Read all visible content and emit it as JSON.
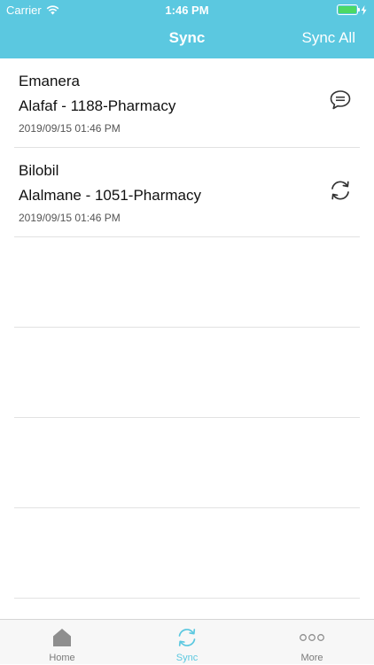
{
  "status": {
    "carrier": "Carrier",
    "time": "1:46 PM"
  },
  "header": {
    "title": "Sync",
    "action": "Sync All"
  },
  "items": [
    {
      "name": "Emanera",
      "place": "Alafaf - 1188-Pharmacy",
      "timestamp": "2019/09/15 01:46 PM",
      "icon": "chat-bubble-icon"
    },
    {
      "name": "Bilobil",
      "place": "Alalmane - 1051-Pharmacy",
      "timestamp": "2019/09/15 01:46 PM",
      "icon": "sync-icon"
    }
  ],
  "tabs": [
    {
      "label": "Home",
      "icon": "home-icon"
    },
    {
      "label": "Sync",
      "icon": "sync-icon"
    },
    {
      "label": "More",
      "icon": "more-dots-icon"
    }
  ],
  "colors": {
    "accent": "#5bc8e0",
    "battery": "#4cd964",
    "tab_inactive": "#7a7a7a"
  }
}
